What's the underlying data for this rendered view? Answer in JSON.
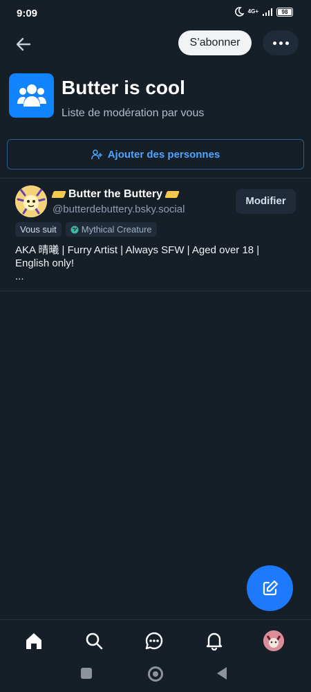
{
  "status": {
    "time": "9:09",
    "network": "4G+",
    "battery": "98"
  },
  "header": {
    "subscribe_label": "S’abonner"
  },
  "list": {
    "title": "Butter is cool",
    "subtitle": "Liste de modération par vous",
    "add_label": "Ajouter des personnes"
  },
  "member": {
    "name": "Butter the Buttery",
    "handle": "@butterdebuttery.bsky.social",
    "edit_label": "Modifier",
    "follows_label": "Vous suit",
    "tag_label": "Mythical Creature",
    "bio_line1": "AKA 晴曦 | Furry Artist | Always SFW | Aged over 18 |",
    "bio_line2": "English only!",
    "bio_more": "..."
  },
  "colors": {
    "background": "#161e27",
    "accent": "#1083fe",
    "link": "#4ea4ff"
  },
  "icons": [
    "back-arrow-icon",
    "more-icon",
    "users-icon",
    "add-person-icon",
    "edit-icon",
    "home-icon",
    "search-icon",
    "chat-icon",
    "bell-icon"
  ]
}
